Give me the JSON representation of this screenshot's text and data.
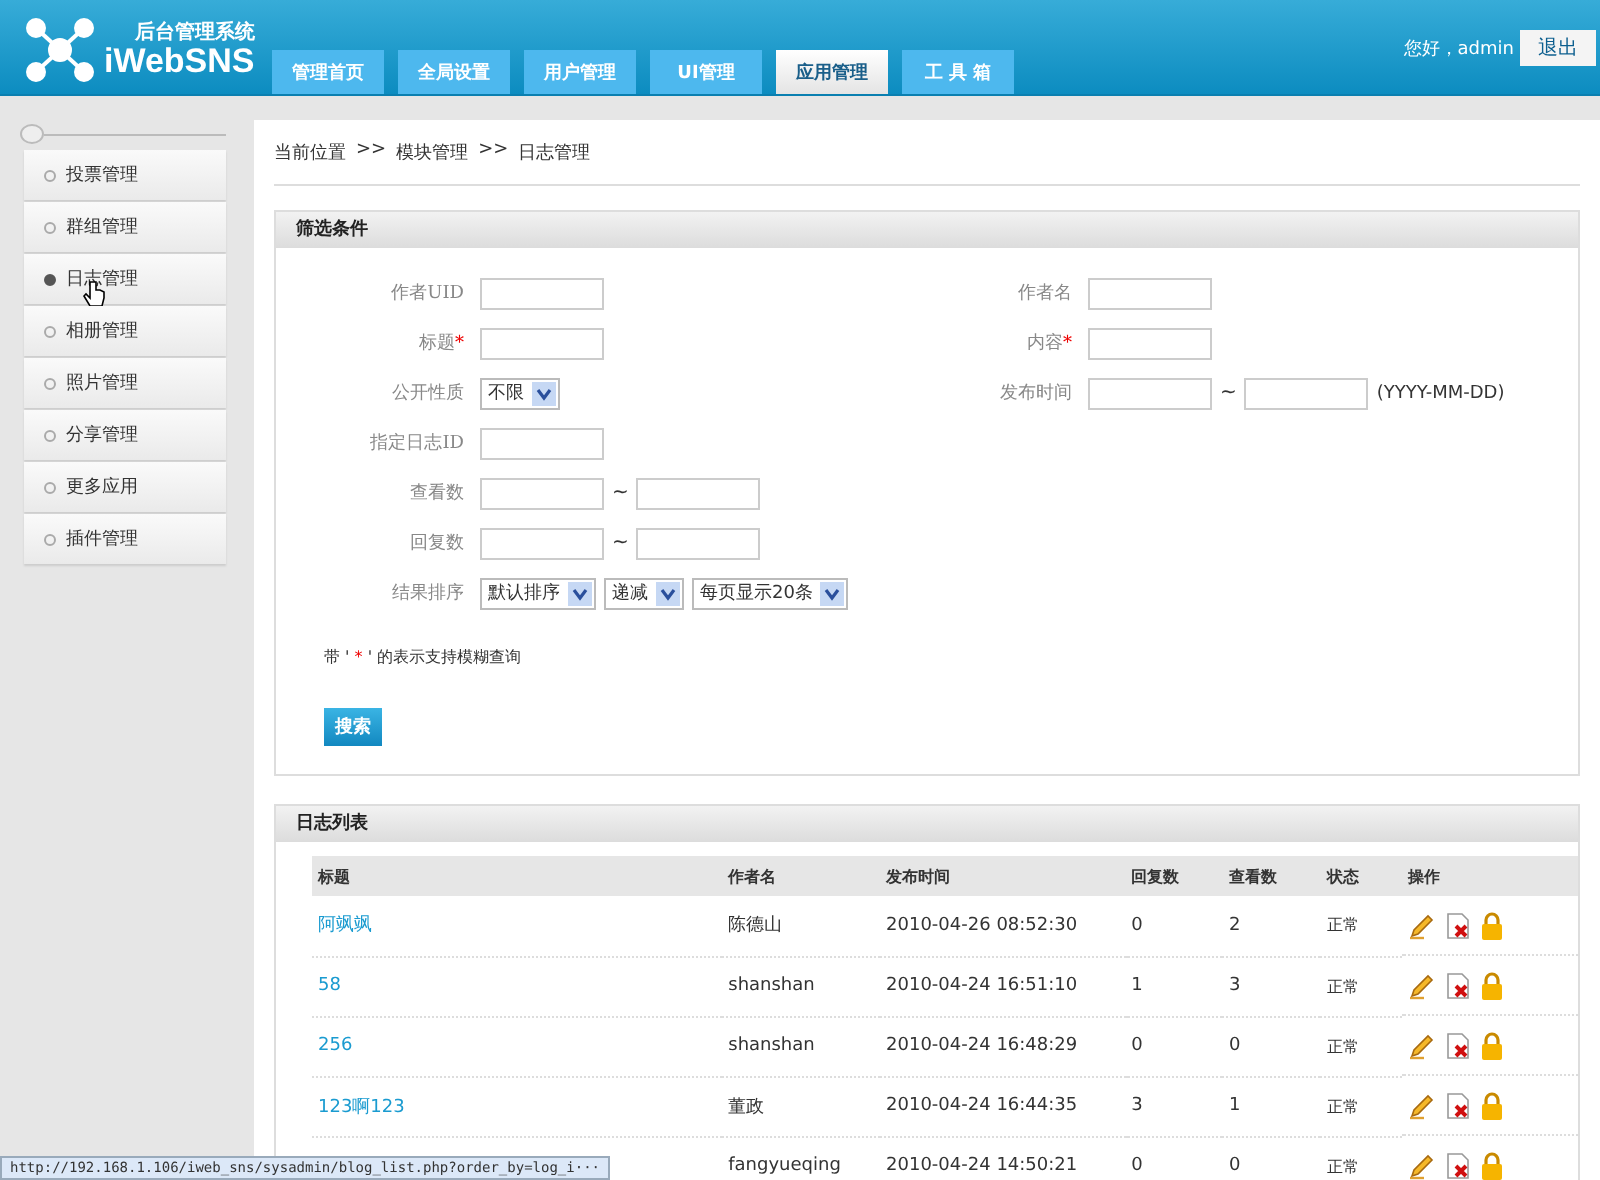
{
  "header": {
    "subtitle": "后台管理系统",
    "logo": "iWebSNS",
    "greeting": "您好，admin",
    "logout": "退出"
  },
  "tabs": [
    {
      "label": "管理首页",
      "selected": false
    },
    {
      "label": "全局设置",
      "selected": false
    },
    {
      "label": "用户管理",
      "selected": false
    },
    {
      "label": "UI管理",
      "selected": false
    },
    {
      "label": "应用管理",
      "selected": true
    },
    {
      "label": "工 具 箱",
      "selected": false
    }
  ],
  "sidebar": {
    "items": [
      {
        "label": "投票管理",
        "selected": false
      },
      {
        "label": "群组管理",
        "selected": false
      },
      {
        "label": "日志管理",
        "selected": true
      },
      {
        "label": "相册管理",
        "selected": false
      },
      {
        "label": "照片管理",
        "selected": false
      },
      {
        "label": "分享管理",
        "selected": false
      },
      {
        "label": "更多应用",
        "selected": false
      },
      {
        "label": "插件管理",
        "selected": false
      }
    ]
  },
  "breadcrumb": [
    "当前位置",
    ">>",
    "模块管理",
    ">>",
    "日志管理"
  ],
  "filter": {
    "title": "筛选条件",
    "rows": [
      {
        "cells": [
          {
            "label": "作者UID",
            "kind": "text"
          },
          {
            "label": "作者名",
            "kind": "text"
          }
        ]
      },
      {
        "cells": [
          {
            "label": "标题",
            "kind": "text",
            "fuzzy_mark": "*"
          },
          {
            "label": "内容",
            "kind": "text",
            "fuzzy_mark": "*"
          }
        ]
      },
      {
        "cells": [
          {
            "label": "公开性质",
            "kind": "select",
            "selects": [
              "不限"
            ]
          },
          {
            "label": "发布时间",
            "kind": "range",
            "separator": "~",
            "hint": "(YYYY-MM-DD)"
          }
        ]
      },
      {
        "cells": [
          {
            "label": "指定日志ID",
            "kind": "text"
          }
        ]
      },
      {
        "cells": [
          {
            "label": "查看数",
            "kind": "range",
            "separator": "~"
          }
        ]
      },
      {
        "cells": [
          {
            "label": "回复数",
            "kind": "range",
            "separator": "~"
          }
        ]
      },
      {
        "cells": [
          {
            "label": "结果排序",
            "kind": "select",
            "selects": [
              "默认排序",
              "递减",
              "每页显示20条"
            ]
          }
        ]
      }
    ],
    "note": {
      "before": "带 ' ",
      "mark": "*",
      "after": " ' 的表示支持模糊查询"
    },
    "search_button": "搜索"
  },
  "list": {
    "title": "日志列表",
    "columns": [
      "标题",
      "作者名",
      "发布时间",
      "回复数",
      "查看数",
      "状态",
      "操作"
    ],
    "rows": [
      {
        "title": "阿飒飒",
        "author": "陈德山",
        "time": "2010-04-26 08:52:30",
        "replies": "0",
        "views": "2",
        "status": "正常"
      },
      {
        "title": "58",
        "author": "shanshan",
        "time": "2010-04-24 16:51:10",
        "replies": "1",
        "views": "3",
        "status": "正常"
      },
      {
        "title": "256",
        "author": "shanshan",
        "time": "2010-04-24 16:48:29",
        "replies": "0",
        "views": "0",
        "status": "正常"
      },
      {
        "title": "123啊123",
        "author": "董政",
        "time": "2010-04-24 16:44:35",
        "replies": "3",
        "views": "1",
        "status": "正常"
      },
      {
        "author": "fangyueqing",
        "time": "2010-04-24 14:50:21",
        "replies": "0",
        "views": "0",
        "status": "正常"
      }
    ]
  },
  "status_bar": "http://192.168.1.106/iweb_sns/sysadmin/blog_list.php?order_by=log_i···"
}
